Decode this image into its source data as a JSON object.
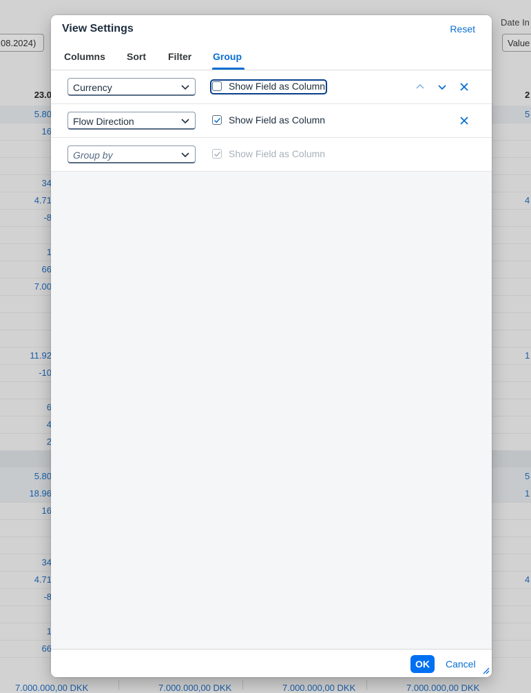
{
  "background": {
    "left_input_value": "08.2024)",
    "right_label": "Date In",
    "right_input_value": "Value",
    "left_column_header": "23.0",
    "right_column_header": "2",
    "rows": [
      {
        "left": "5.80",
        "right": "5",
        "style": "shade"
      },
      {
        "left": "16",
        "right": "",
        "style": ""
      },
      {
        "left": "",
        "right": "",
        "style": ""
      },
      {
        "left": "",
        "right": "",
        "style": ""
      },
      {
        "left": "34",
        "right": "",
        "style": ""
      },
      {
        "left": "4.71",
        "right": "4",
        "style": ""
      },
      {
        "left": "-8",
        "right": "",
        "style": ""
      },
      {
        "left": "",
        "right": "",
        "style": ""
      },
      {
        "left": "1",
        "right": "",
        "style": ""
      },
      {
        "left": "66",
        "right": "",
        "style": ""
      },
      {
        "left": "7.00",
        "right": "",
        "style": ""
      },
      {
        "left": "",
        "right": "",
        "style": ""
      },
      {
        "left": "",
        "right": "",
        "style": ""
      },
      {
        "left": "",
        "right": "",
        "style": ""
      },
      {
        "left": "11.92",
        "right": "1",
        "style": ""
      },
      {
        "left": "-10",
        "right": "",
        "style": ""
      },
      {
        "left": "",
        "right": "",
        "style": ""
      },
      {
        "left": "6",
        "right": "",
        "style": ""
      },
      {
        "left": "4",
        "right": "",
        "style": ""
      },
      {
        "left": "2",
        "right": "",
        "style": ""
      },
      {
        "left": "",
        "right": "",
        "style": "dark"
      },
      {
        "left": "5.80",
        "right": "5",
        "style": "shade"
      },
      {
        "left": "18.96",
        "right": "1",
        "style": "shade"
      },
      {
        "left": "16",
        "right": "",
        "style": ""
      },
      {
        "left": "",
        "right": "",
        "style": ""
      },
      {
        "left": "",
        "right": "",
        "style": ""
      },
      {
        "left": "34",
        "right": "",
        "style": ""
      },
      {
        "left": "4.71",
        "right": "4",
        "style": ""
      },
      {
        "left": "-8",
        "right": "",
        "style": ""
      },
      {
        "left": "",
        "right": "",
        "style": ""
      },
      {
        "left": "1",
        "right": "",
        "style": ""
      },
      {
        "left": "66",
        "right": "",
        "style": ""
      }
    ],
    "bottom_totals": [
      "7.000.000,00 DKK",
      "7.000.000,00 DKK",
      "7.000.000,00 DKK",
      "7.000.000,00 DKK"
    ]
  },
  "dialog": {
    "title": "View Settings",
    "reset_label": "Reset",
    "tabs": [
      {
        "label": "Columns",
        "active": false
      },
      {
        "label": "Sort",
        "active": false
      },
      {
        "label": "Filter",
        "active": false
      },
      {
        "label": "Group",
        "active": true
      }
    ],
    "group_rows": [
      {
        "select_value": "Currency",
        "placeholder": false,
        "checkbox_label": "Show Field as Column",
        "checked": false,
        "disabled": false,
        "focused": true,
        "move_up": true,
        "move_down": true,
        "remove": true
      },
      {
        "select_value": "Flow Direction",
        "placeholder": false,
        "checkbox_label": "Show Field as Column",
        "checked": true,
        "disabled": false,
        "focused": false,
        "move_up": false,
        "move_down": false,
        "remove": true
      },
      {
        "select_value": "Group by",
        "placeholder": true,
        "checkbox_label": "Show Field as Column",
        "checked": true,
        "disabled": true,
        "focused": false,
        "move_up": false,
        "move_down": false,
        "remove": false
      }
    ],
    "ok_label": "OK",
    "cancel_label": "Cancel"
  },
  "colors": {
    "accent": "#0a6ed1",
    "ok_button": "#0070f2",
    "dialog_bg": "#f5f6f7"
  }
}
